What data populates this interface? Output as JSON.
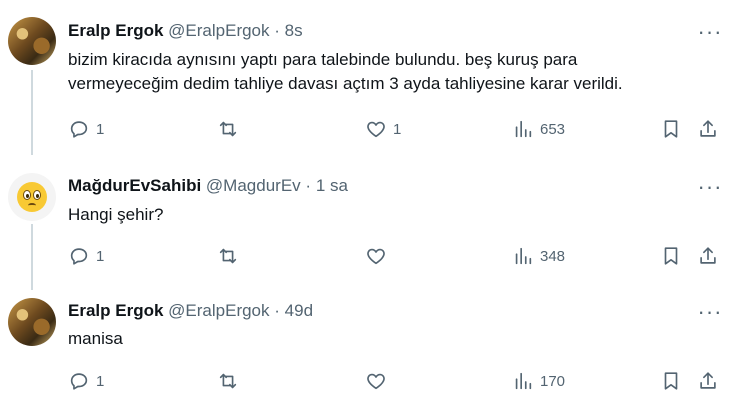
{
  "tweets": [
    {
      "name": "Eralp Ergok",
      "handle": "@EralpErgok",
      "sep": "·",
      "time": "8s",
      "avatar": "landscape-photo",
      "text_lines": [
        "bizim kiracıda aynısını yaptı para talebinde bulundu. beş kuruş para",
        "vermeyeceğim dedim tahliye davası açtım 3 ayda tahliyesine karar verildi."
      ],
      "reply_count": "1",
      "retweet_count": "",
      "like_count": "1",
      "view_count": "653"
    },
    {
      "name": "MağdurEvSahibi",
      "handle": "@MagdurEv",
      "sep": "·",
      "time": "1 sa",
      "avatar": "worried-face-emoji",
      "text_lines": [
        "Hangi şehir?"
      ],
      "reply_count": "1",
      "retweet_count": "",
      "like_count": "",
      "view_count": "348"
    },
    {
      "name": "Eralp Ergok",
      "handle": "@EralpErgok",
      "sep": "·",
      "time": "49d",
      "avatar": "landscape-photo",
      "text_lines": [
        "manisa"
      ],
      "reply_count": "1",
      "retweet_count": "",
      "like_count": "",
      "view_count": "170"
    }
  ],
  "more_glyph": "···",
  "icons": [
    "reply-icon",
    "retweet-icon",
    "like-icon",
    "views-icon",
    "bookmark-icon",
    "share-icon"
  ]
}
